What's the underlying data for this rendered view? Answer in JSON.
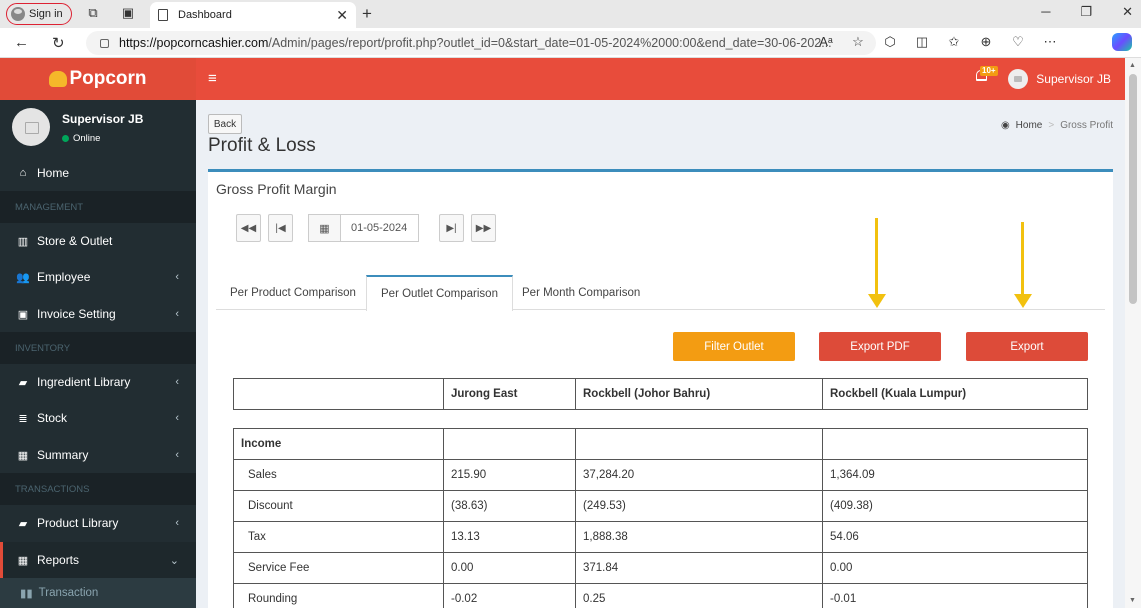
{
  "browser": {
    "signin_label": "Sign in",
    "tab_title": "Dashboard",
    "url_host": "https://popcorncashier.com",
    "url_path": "/Admin/pages/report/profit.php?outlet_id=0&start_date=01-05-2024%2000:00&end_date=30-06-202..."
  },
  "app": {
    "logo_text": "Popcorn",
    "notification_badge": "10+",
    "user_name": "Supervisor JB",
    "user_status": "Online"
  },
  "sidebar": {
    "home": "Home",
    "management_header": "MANAGEMENT",
    "store_outlet": "Store & Outlet",
    "employee": "Employee",
    "invoice_setting": "Invoice Setting",
    "inventory_header": "INVENTORY",
    "ingredient_library": "Ingredient Library",
    "stock": "Stock",
    "summary": "Summary",
    "transactions_header": "TRANSACTIONS",
    "product_library": "Product Library",
    "reports": "Reports",
    "transaction": "Transaction"
  },
  "page": {
    "back_label": "Back",
    "title": "Profit & Loss",
    "breadcrumb_home": "Home",
    "breadcrumb_current": "Gross Profit",
    "box_title": "Gross Profit Margin",
    "date_value": "01-05-2024"
  },
  "tabs": [
    "Per Product Comparison",
    "Per Outlet Comparison",
    "Per Month Comparison"
  ],
  "buttons": {
    "filter": "Filter Outlet",
    "export_pdf": "Export PDF",
    "export": "Export"
  },
  "table": {
    "columns": [
      "",
      "Jurong East",
      "Rockbell (Johor Bahru)",
      "Rockbell (Kuala Lumpur)"
    ],
    "rows": [
      {
        "label": "Income",
        "values": [
          "",
          "",
          ""
        ]
      },
      {
        "label": "Sales",
        "values": [
          "215.90",
          "37,284.20",
          "1,364.09"
        ]
      },
      {
        "label": "Discount",
        "values": [
          "(38.63)",
          "(249.53)",
          "(409.38)"
        ]
      },
      {
        "label": "Tax",
        "values": [
          "13.13",
          "1,888.38",
          "54.06"
        ]
      },
      {
        "label": "Service Fee",
        "values": [
          "0.00",
          "371.84",
          "0.00"
        ]
      },
      {
        "label": "Rounding",
        "values": [
          "-0.02",
          "0.25",
          "-0.01"
        ]
      }
    ]
  }
}
